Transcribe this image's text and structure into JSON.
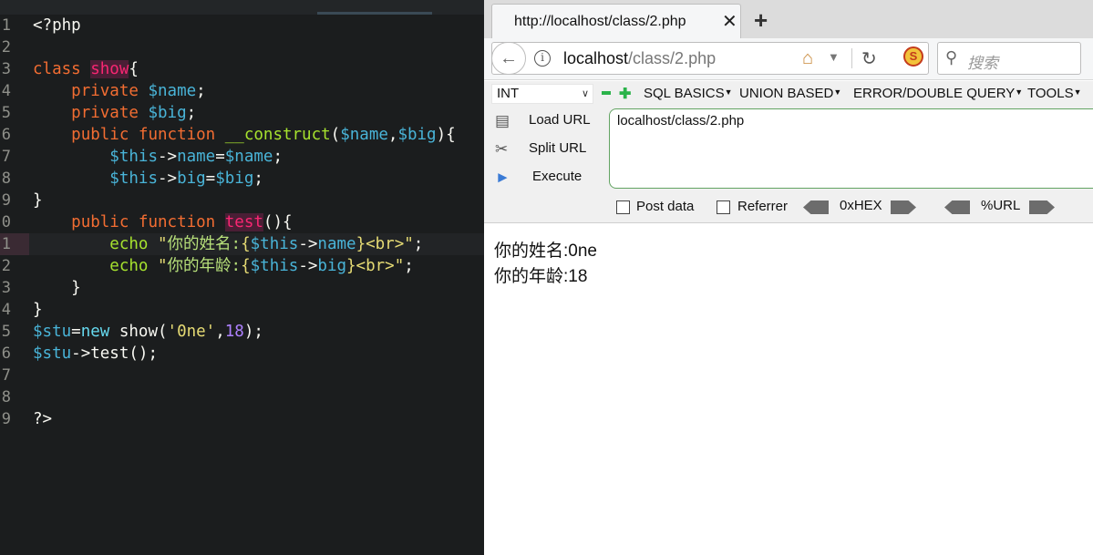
{
  "editor": {
    "lines": [
      {
        "n": "1",
        "tokens": [
          [
            "plain",
            "<?php"
          ]
        ]
      },
      {
        "n": "2",
        "tokens": []
      },
      {
        "n": "3",
        "tokens": [
          [
            "kw",
            "class"
          ],
          [
            "plain",
            " "
          ],
          [
            "cls",
            "show"
          ],
          [
            "plain",
            "{"
          ]
        ]
      },
      {
        "n": "4",
        "tokens": [
          [
            "plain",
            "    "
          ],
          [
            "kw",
            "private"
          ],
          [
            "plain",
            " "
          ],
          [
            "var",
            "$name"
          ],
          [
            "plain",
            ";"
          ]
        ]
      },
      {
        "n": "5",
        "tokens": [
          [
            "plain",
            "    "
          ],
          [
            "kw",
            "private"
          ],
          [
            "plain",
            " "
          ],
          [
            "var",
            "$big"
          ],
          [
            "plain",
            ";"
          ]
        ]
      },
      {
        "n": "6",
        "tokens": [
          [
            "plain",
            "    "
          ],
          [
            "kw",
            "public"
          ],
          [
            "plain",
            " "
          ],
          [
            "kw",
            "function"
          ],
          [
            "plain",
            " "
          ],
          [
            "fn",
            "__construct"
          ],
          [
            "plain",
            "("
          ],
          [
            "var",
            "$name"
          ],
          [
            "plain",
            ","
          ],
          [
            "var",
            "$big"
          ],
          [
            "plain",
            "){"
          ]
        ]
      },
      {
        "n": "7",
        "tokens": [
          [
            "plain",
            "        "
          ],
          [
            "var",
            "$this"
          ],
          [
            "op",
            "->"
          ],
          [
            "prop",
            "name"
          ],
          [
            "op",
            "="
          ],
          [
            "var",
            "$name"
          ],
          [
            "plain",
            ";"
          ]
        ]
      },
      {
        "n": "8",
        "tokens": [
          [
            "plain",
            "        "
          ],
          [
            "var",
            "$this"
          ],
          [
            "op",
            "->"
          ],
          [
            "prop",
            "big"
          ],
          [
            "op",
            "="
          ],
          [
            "var",
            "$big"
          ],
          [
            "plain",
            ";"
          ]
        ]
      },
      {
        "n": "9",
        "tokens": [
          [
            "plain",
            "}"
          ]
        ]
      },
      {
        "n": "0",
        "tokens": [
          [
            "plain",
            "    "
          ],
          [
            "kw",
            "public"
          ],
          [
            "plain",
            " "
          ],
          [
            "kw",
            "function"
          ],
          [
            "plain",
            " "
          ],
          [
            "mth",
            "test"
          ],
          [
            "plain",
            "(){"
          ]
        ]
      },
      {
        "n": "1",
        "tokens": [
          [
            "plain",
            "        "
          ],
          [
            "fn",
            "echo"
          ],
          [
            "plain",
            " "
          ],
          [
            "str",
            "\""
          ],
          [
            "strcn",
            "你的姓名:"
          ],
          [
            "str",
            "{"
          ],
          [
            "var",
            "$this"
          ],
          [
            "op",
            "->"
          ],
          [
            "prop",
            "name"
          ],
          [
            "str",
            "}<br>\""
          ],
          [
            "plain",
            ";"
          ]
        ]
      },
      {
        "n": "2",
        "tokens": [
          [
            "plain",
            "        "
          ],
          [
            "fn",
            "echo"
          ],
          [
            "plain",
            " "
          ],
          [
            "str",
            "\""
          ],
          [
            "strcn",
            "你的年龄:"
          ],
          [
            "str",
            "{"
          ],
          [
            "var",
            "$this"
          ],
          [
            "op",
            "->"
          ],
          [
            "prop",
            "big"
          ],
          [
            "str",
            "}<br>\""
          ],
          [
            "plain",
            ";"
          ]
        ]
      },
      {
        "n": "3",
        "tokens": [
          [
            "plain",
            "    }"
          ]
        ]
      },
      {
        "n": "4",
        "tokens": [
          [
            "plain",
            "}"
          ]
        ]
      },
      {
        "n": "5",
        "tokens": [
          [
            "var",
            "$stu"
          ],
          [
            "op",
            "="
          ],
          [
            "func",
            "new"
          ],
          [
            "plain",
            " show("
          ],
          [
            "str",
            "'0ne'"
          ],
          [
            "plain",
            ","
          ],
          [
            "num",
            "18"
          ],
          [
            "plain",
            ");"
          ]
        ]
      },
      {
        "n": "6",
        "tokens": [
          [
            "var",
            "$stu"
          ],
          [
            "op",
            "->"
          ],
          [
            "plain",
            "test();"
          ]
        ]
      },
      {
        "n": "7",
        "tokens": []
      },
      {
        "n": "8",
        "tokens": []
      },
      {
        "n": "9",
        "tokens": [
          [
            "plain",
            "?>"
          ]
        ]
      }
    ]
  },
  "browser": {
    "tab_title": "http://localhost/class/2.php",
    "tab_close": "✕",
    "new_tab": "+",
    "url_host": "localhost",
    "url_path": "/class/2.php",
    "search_placeholder": "搜索",
    "hackbar": {
      "select_value": "INT",
      "menus": [
        "SQL BASICS",
        "UNION BASED",
        "ERROR/DOUBLE QUERY",
        "TOOLS"
      ],
      "load_url": "Load URL",
      "split_url": "Split URL",
      "execute": "Execute",
      "url_value": "localhost/class/2.php",
      "post_data": "Post data",
      "referrer": "Referrer",
      "hex": "0xHEX",
      "url_enc": "%URL"
    },
    "output": [
      "你的姓名:0ne",
      "你的年龄:18"
    ]
  },
  "colors": {
    "editor_bg": "#1b1d1e",
    "keyword": "#f26d32",
    "variable": "#49b4d8",
    "string": "#e6db74",
    "hackbar_border": "#62a362"
  }
}
